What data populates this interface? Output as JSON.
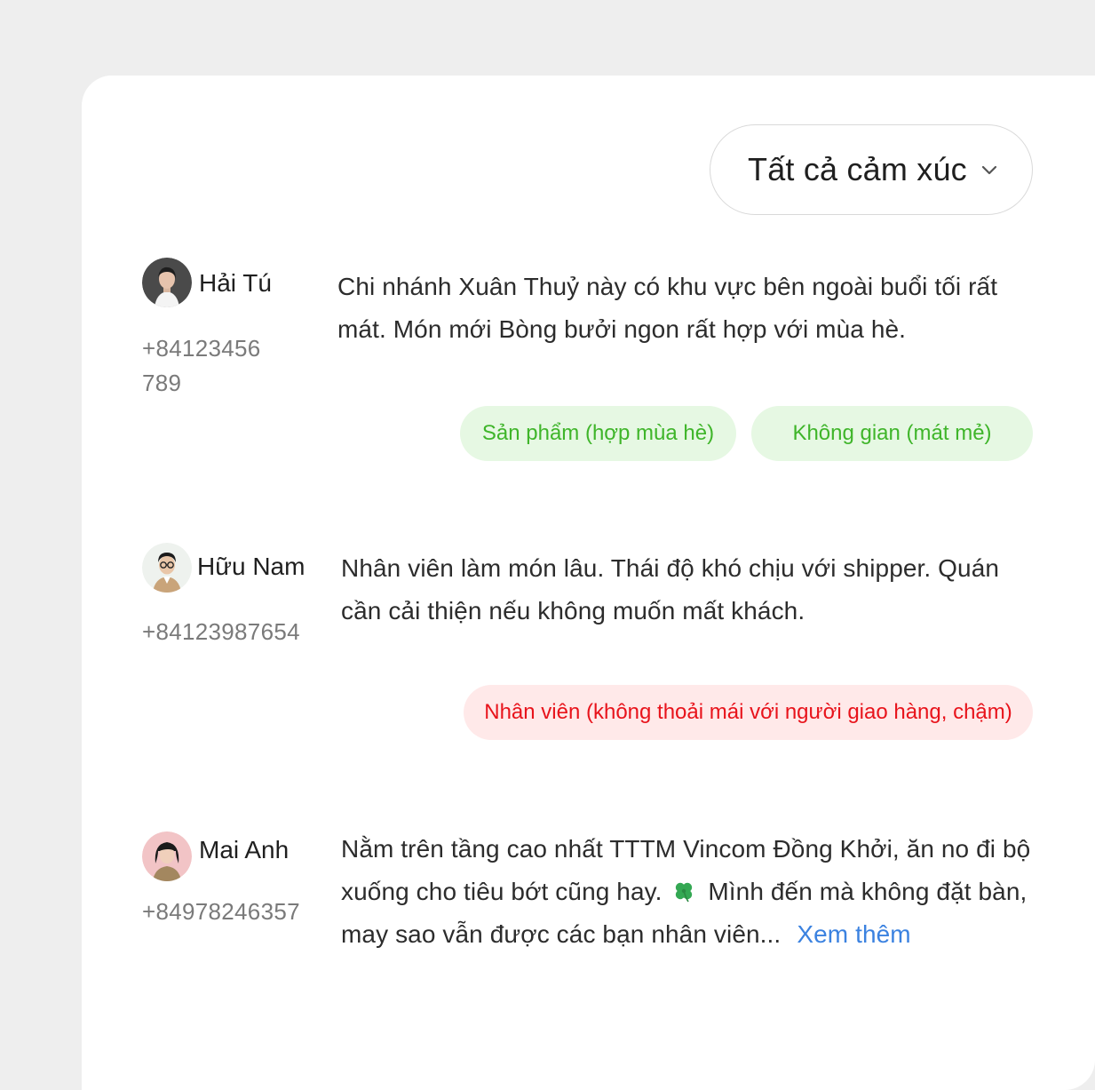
{
  "filter": {
    "label": "Tất cả cảm xúc",
    "icon": "chevron-down-icon"
  },
  "colors": {
    "positive_bg": "#e6f8e3",
    "positive_text": "#3fb52a",
    "negative_bg": "#ffe9e9",
    "negative_text": "#e8131b",
    "link": "#3b82e0"
  },
  "reviews": [
    {
      "name": "Hải Tú",
      "phone": "+84123456789",
      "comment": "Chi nhánh Xuân Thuỷ này có khu vực bên ngoài buổi tối rất mát. Món mới Bòng bưởi ngon rất hợp với mùa hè.",
      "tags": [
        {
          "label": "Sản phẩm (hợp mùa hè)",
          "sentiment": "positive"
        },
        {
          "label": "Không gian (mát mẻ)",
          "sentiment": "positive"
        }
      ]
    },
    {
      "name": "Hữu Nam",
      "phone": "+84123987654",
      "comment": "Nhân viên làm món lâu. Thái độ khó chịu với shipper. Quán cần cải thiện nếu không muốn mất khách.",
      "tags": [
        {
          "label": "Nhân viên (không thoải mái với người giao hàng, chậm)",
          "sentiment": "negative"
        }
      ]
    },
    {
      "name": "Mai Anh",
      "phone": "+84978246357",
      "comment_part1": "Nằm trên tầng cao nhất TTTM Vincom Đồng Khởi, ăn no đi bộ xuống cho tiêu bớt cũng hay.",
      "comment_emoji": "four-leaf-clover-icon",
      "comment_part2": "Mình đến mà không đặt bàn, may sao vẫn được các bạn nhân viên...",
      "see_more": "Xem thêm",
      "tags": []
    }
  ]
}
